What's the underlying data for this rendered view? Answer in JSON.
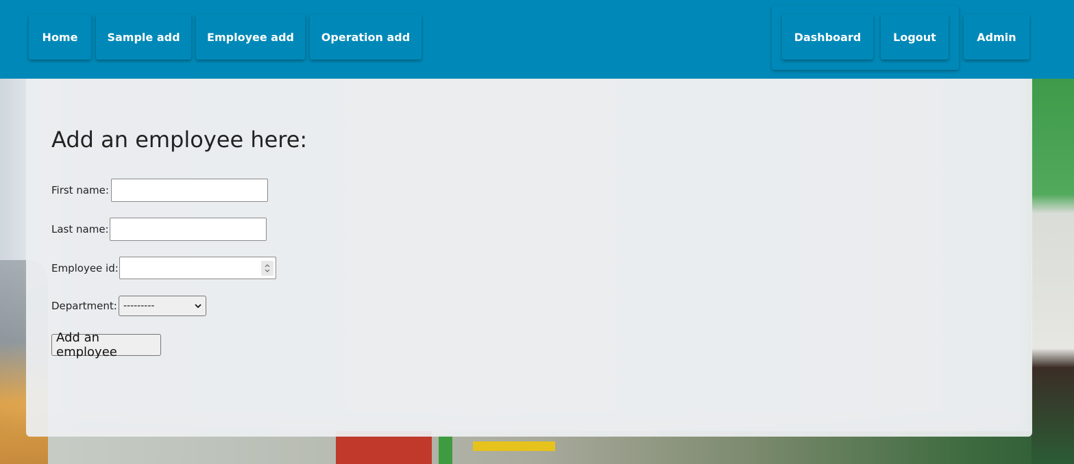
{
  "navbar": {
    "left_items": [
      {
        "label": "Home"
      },
      {
        "label": "Sample add"
      },
      {
        "label": "Employee add"
      },
      {
        "label": "Operation add"
      }
    ],
    "right_items": [
      {
        "label": "Dashboard"
      },
      {
        "label": "Logout"
      },
      {
        "label": "Admin"
      }
    ]
  },
  "form": {
    "heading": "Add an employee here:",
    "first_name": {
      "label": "First name:",
      "value": ""
    },
    "last_name": {
      "label": "Last name:",
      "value": ""
    },
    "employee_id": {
      "label": "Employee id:",
      "value": ""
    },
    "department": {
      "label": "Department:",
      "selected": "---------"
    },
    "submit_label": "Add an employee"
  },
  "colors": {
    "navbar_bg": "#0089b8",
    "nav_text": "#ffffff",
    "card_bg": "#eceef0"
  }
}
